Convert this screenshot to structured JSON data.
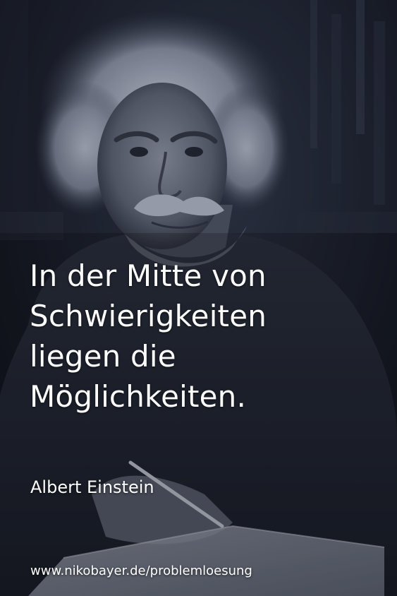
{
  "quote": {
    "lines": [
      "In der Mitte von",
      "Schwierigkeiten",
      "liegen die",
      "Möglichkeiten."
    ]
  },
  "author": "Albert Einstein",
  "website": "www.nikobayer.de/problemloesung",
  "colors": {
    "background": "#0f1016",
    "text": "#ffffff",
    "tint": "#2a3248"
  }
}
